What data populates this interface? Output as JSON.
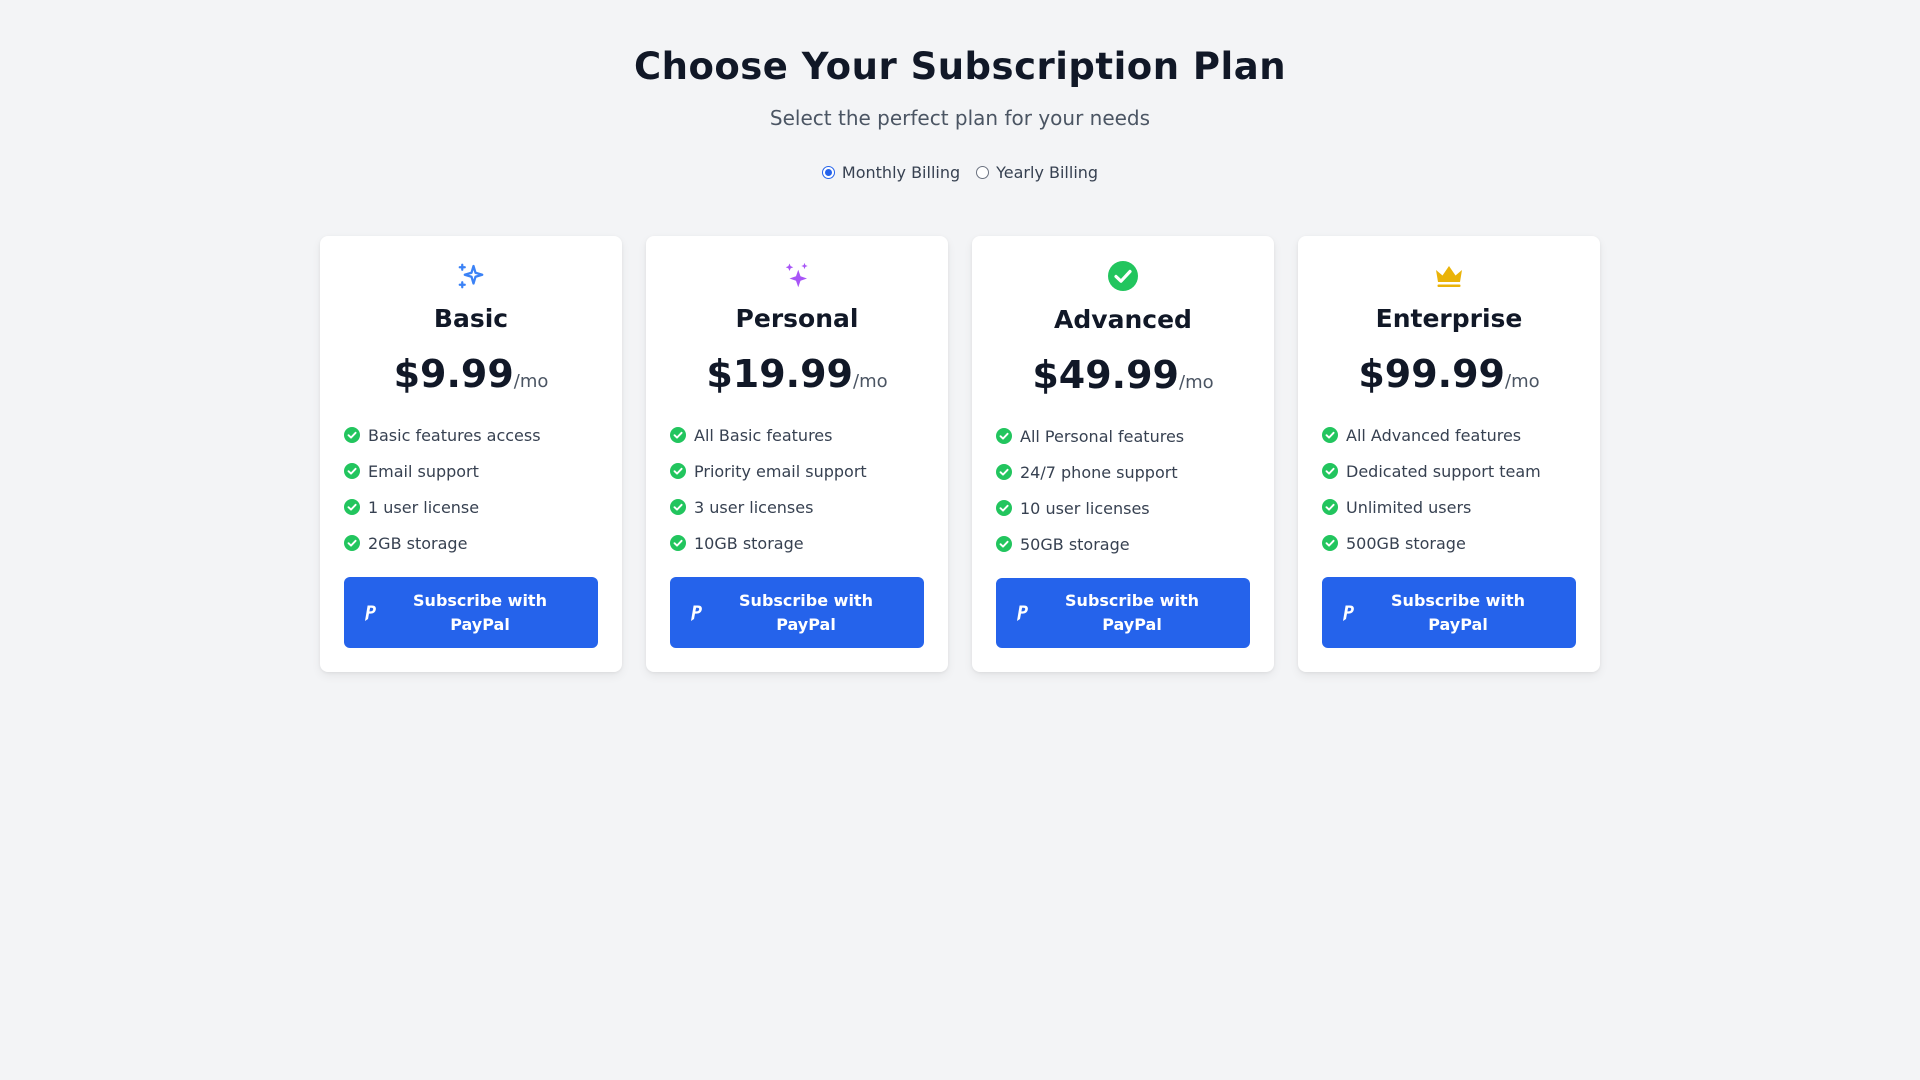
{
  "header": {
    "title": "Choose Your Subscription Plan",
    "subtitle": "Select the perfect plan for your needs"
  },
  "billing": {
    "options": [
      {
        "label": "Monthly Billing",
        "selected": true
      },
      {
        "label": "Yearly Billing",
        "selected": false
      }
    ]
  },
  "plans": [
    {
      "icon": "sparkles-outline-icon",
      "icon_color": "#3b82f6",
      "name": "Basic",
      "price": "$9.99",
      "period": "/mo",
      "features": [
        "Basic features access",
        "Email support",
        "1 user license",
        "2GB storage"
      ],
      "button_label": "Subscribe with PayPal"
    },
    {
      "icon": "sparkles-icon",
      "icon_color": "#a855f7",
      "name": "Personal",
      "price": "$19.99",
      "period": "/mo",
      "features": [
        "All Basic features",
        "Priority email support",
        "3 user licenses",
        "10GB storage"
      ],
      "button_label": "Subscribe with PayPal"
    },
    {
      "icon": "check-circle-icon",
      "icon_color": "#22c55e",
      "name": "Advanced",
      "price": "$49.99",
      "period": "/mo",
      "features": [
        "All Personal features",
        "24/7 phone support",
        "10 user licenses",
        "50GB storage"
      ],
      "button_label": "Subscribe with PayPal"
    },
    {
      "icon": "crown-icon",
      "icon_color": "#eab308",
      "name": "Enterprise",
      "price": "$99.99",
      "period": "/mo",
      "features": [
        "All Advanced features",
        "Dedicated support team",
        "Unlimited users",
        "500GB storage"
      ],
      "button_label": "Subscribe with PayPal"
    }
  ],
  "colors": {
    "accent": "#2563eb",
    "check": "#22c55e",
    "background": "#f3f4f6"
  }
}
